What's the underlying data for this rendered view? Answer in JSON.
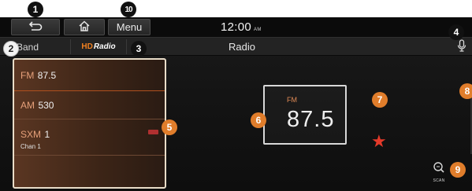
{
  "callouts": {
    "c1": "1",
    "c2": "2",
    "c3": "3",
    "c4": "4",
    "c5": "5",
    "c6": "6",
    "c7": "7",
    "c8": "8",
    "c9": "9",
    "c10": "10"
  },
  "topbar": {
    "back_icon": "back-arrow-icon",
    "home_icon": "home-icon",
    "menu_label": "Menu",
    "clock_time": "12:00",
    "clock_ampm": "AM"
  },
  "subbar": {
    "band_label": "Band",
    "source_hd": "HD",
    "source_label": "Radio",
    "page_title": "Radio",
    "mic_icon": "microphone-icon"
  },
  "station_list": [
    {
      "band": "FM",
      "freq": "87.5",
      "sub": ""
    },
    {
      "band": "AM",
      "freq": "530",
      "sub": ""
    },
    {
      "band": "SXM",
      "freq": "1",
      "sub": "Chan 1"
    }
  ],
  "now_playing": {
    "band": "FM",
    "freq": "87.5",
    "favorite_icon": "star-icon"
  },
  "scan": {
    "label": "SCAN",
    "icon": "scan-icon"
  },
  "colors": {
    "accent": "#e07d2b",
    "favorite": "#e43a2a",
    "list_bg": "#4a2d1c"
  }
}
